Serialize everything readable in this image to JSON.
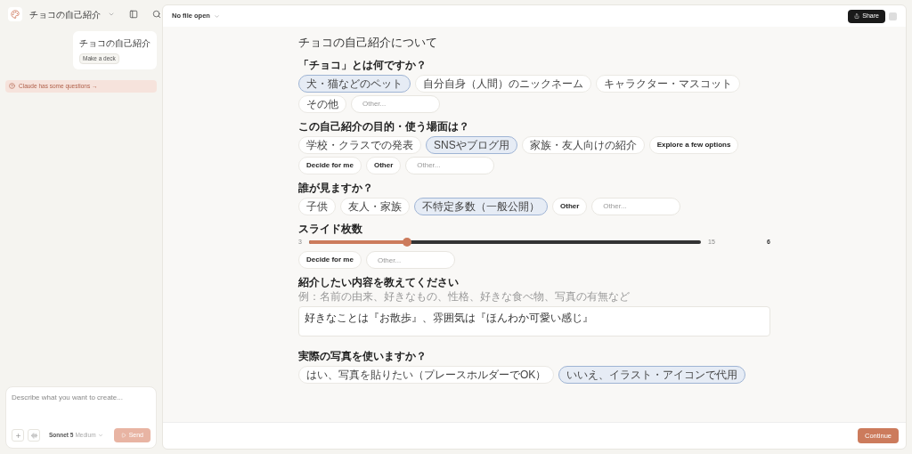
{
  "sidebar": {
    "project": "チョコの自己紹介",
    "message": {
      "text": "チョコの自己紹介",
      "tag": "Make a deck"
    },
    "notice": "Claude has some questions →",
    "composer": {
      "placeholder": "Describe what you want to create...",
      "model": "Sonnet 5",
      "effort": "Medium",
      "send": "Send"
    }
  },
  "header": {
    "file": "No file open",
    "share": "Share"
  },
  "form": {
    "title": "チョコの自己紹介について",
    "questions": [
      {
        "kind": "choice",
        "label": "「チョコ」とは何ですか？",
        "options": [
          {
            "kind": "option",
            "text": "犬・猫などのペット",
            "selected": true
          },
          {
            "kind": "option",
            "text": "自分自身（人間）のニックネーム",
            "selected": false
          },
          {
            "kind": "option",
            "text": "キャラクター・マスコット",
            "selected": false
          },
          {
            "kind": "option",
            "text": "その他",
            "selected": false
          },
          {
            "kind": "input",
            "placeholder": "Other..."
          }
        ]
      },
      {
        "kind": "choice",
        "label": "この自己紹介の目的・使う場面は？",
        "options": [
          {
            "kind": "option",
            "text": "学校・クラスでの発表",
            "selected": false
          },
          {
            "kind": "option",
            "text": "SNSやブログ用",
            "selected": true
          },
          {
            "kind": "option",
            "text": "家族・友人向けの紹介",
            "selected": false
          },
          {
            "kind": "action",
            "text": "Explore a few options",
            "selected": false
          },
          {
            "kind": "action",
            "text": "Decide for me",
            "selected": false
          },
          {
            "kind": "action",
            "text": "Other",
            "selected": false
          },
          {
            "kind": "input",
            "placeholder": "Other..."
          }
        ]
      },
      {
        "kind": "choice",
        "label": "誰が見ますか？",
        "options": [
          {
            "kind": "option",
            "text": "子供",
            "selected": false
          },
          {
            "kind": "option",
            "text": "友人・家族",
            "selected": false
          },
          {
            "kind": "option",
            "text": "不特定多数（一般公開）",
            "selected": true
          },
          {
            "kind": "action",
            "text": "Other",
            "selected": false
          },
          {
            "kind": "input",
            "placeholder": "Other..."
          }
        ]
      },
      {
        "kind": "slider",
        "label": "スライド枚数",
        "min": "3",
        "max": "15",
        "value": "6",
        "level": 0.25,
        "options": [
          {
            "kind": "action",
            "text": "Decide for me",
            "selected": false
          },
          {
            "kind": "input",
            "placeholder": "Other..."
          }
        ]
      },
      {
        "kind": "text",
        "label": "紹介したい内容を教えてください",
        "hint": "例：名前の由来、好きなもの、性格、好きな食べ物、写真の有無など",
        "value": "好きなことは『お散歩』、雰囲気は『ほんわか可愛い感じ』"
      },
      {
        "kind": "choice",
        "label": "実際の写真を使いますか？",
        "options": [
          {
            "kind": "option",
            "text": "はい、写真を貼りたい（プレースホルダーでOK）",
            "selected": false
          },
          {
            "kind": "option",
            "text": "いいえ、イラスト・アイコンで代用",
            "selected": true
          }
        ]
      }
    ]
  },
  "footer": {
    "continue": "Continue"
  }
}
